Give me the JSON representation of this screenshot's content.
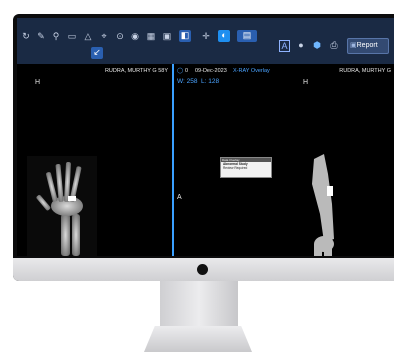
{
  "toolbar": {
    "tools": [
      "rotate-icon",
      "pen-icon",
      "zoom-icon",
      "rect-icon",
      "angle-icon",
      "crosshair-icon",
      "play-icon",
      "camera-icon",
      "layout-icon",
      "grid-icon",
      "display-icon",
      "move-icon",
      "contrast-icon",
      "layers-icon",
      "text-box-icon",
      "circle-icon",
      "cube-icon",
      "print-icon"
    ],
    "report_label": "Report"
  },
  "left_view": {
    "patient": "RUDRA, MURTHY G 58Y",
    "orientation_top": "H"
  },
  "right_view": {
    "series_number": "0",
    "date": "09-Dec-2023",
    "series_desc": "X-RAY Overlay",
    "window": "W: 258",
    "level": "L: 128",
    "patient": "RUDRA, MURTHY G",
    "orientation_top": "H",
    "orientation_side": "A"
  },
  "popup": {
    "header": "Data Overlay",
    "line1": "Abnormal Study",
    "line2": "Review Required"
  }
}
